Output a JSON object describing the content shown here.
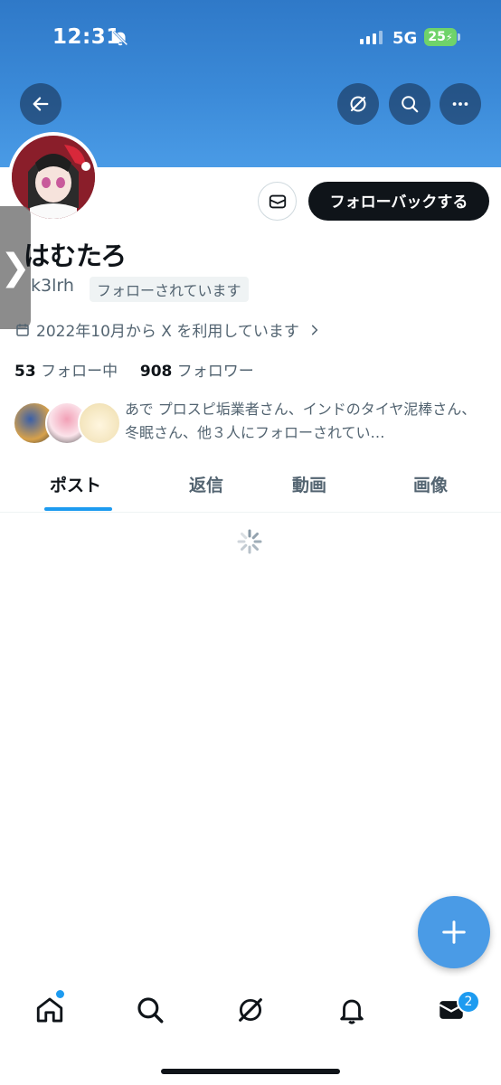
{
  "status_bar": {
    "time": "12:31",
    "network": "5G",
    "battery": "25"
  },
  "header": {
    "icons": [
      "back-arrow-icon",
      "grok-icon",
      "search-icon",
      "more-icon"
    ]
  },
  "profile": {
    "display_name": "はむたろ",
    "handle": "k3lrh",
    "follows_you_badge": "フォローされています",
    "joined": "2022年10月から X を利用しています",
    "following_count": "53",
    "following_label": "フォロー中",
    "followers_count": "908",
    "followers_label": "フォロワー",
    "mutual_followers": "あで プロスピ垢業者さん、インドのタイヤ泥棒さん、冬眠さん、他３人にフォローされてい…",
    "follow_back_button": "フォローバックする",
    "side_panel_glyph": "❯"
  },
  "tabs": [
    {
      "label": "ポスト",
      "active": true
    },
    {
      "label": "返信",
      "active": false
    },
    {
      "label": "動画",
      "active": false
    },
    {
      "label": "画像",
      "active": false
    }
  ],
  "bottom_nav": {
    "messages_badge": "2"
  },
  "colors": {
    "accent": "#1d9bf0",
    "banner": "#3b8ad8",
    "fab": "#4a9be6"
  }
}
